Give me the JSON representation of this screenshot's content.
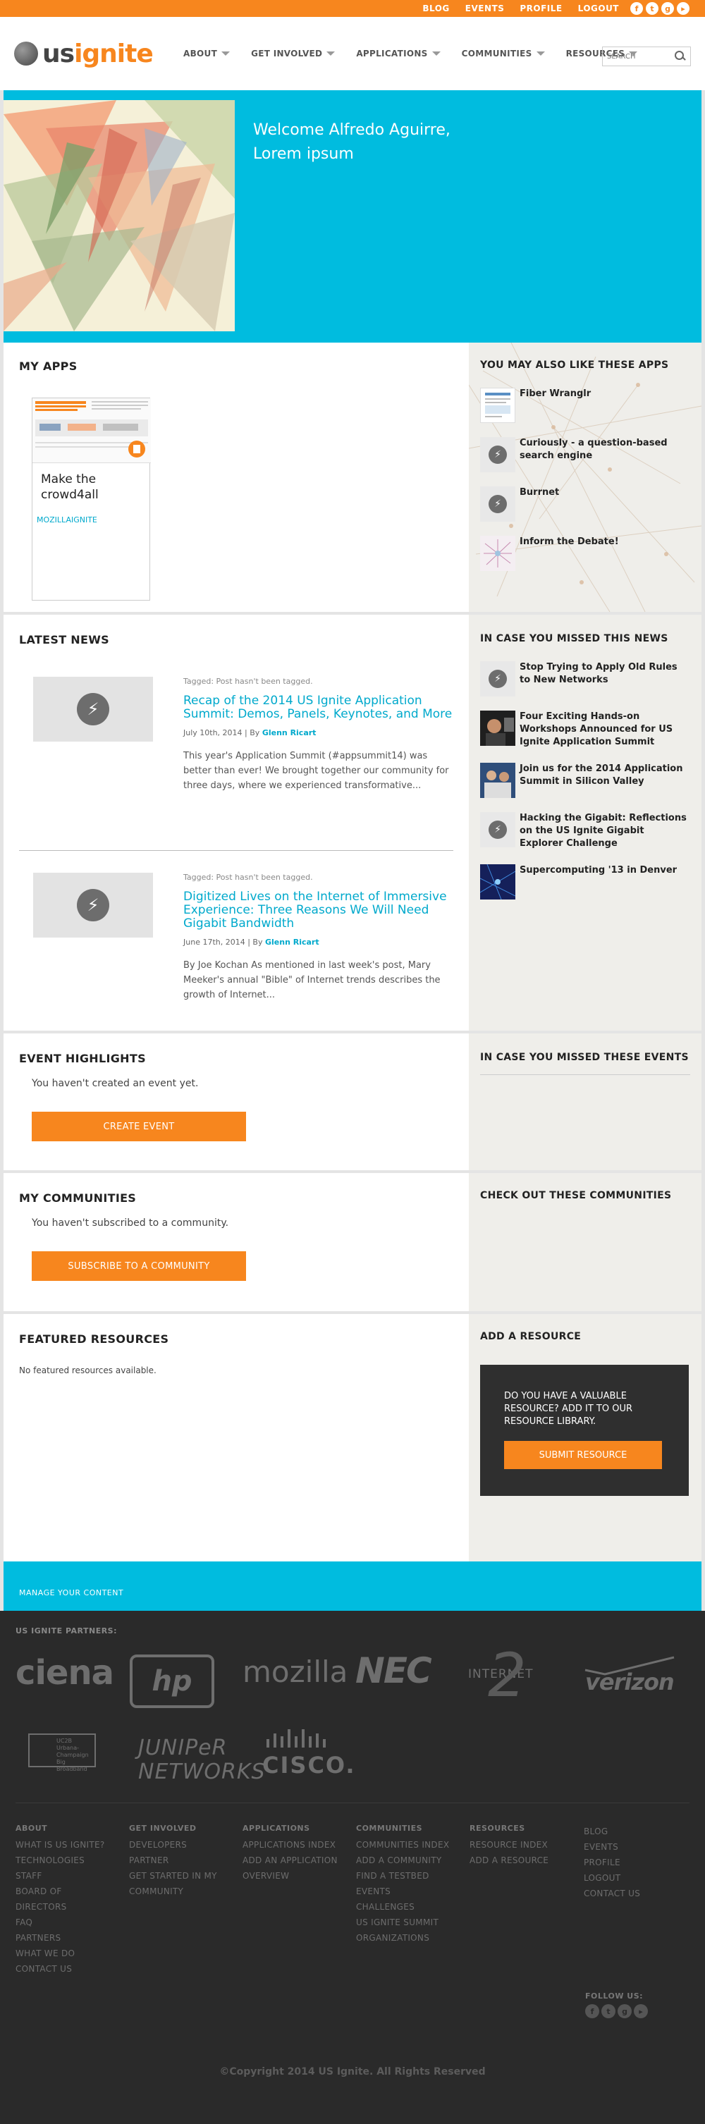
{
  "topbar": {
    "links": [
      "BLOG",
      "EVENTS",
      "PROFILE",
      "LOGOUT"
    ],
    "social_icons": [
      "facebook-icon",
      "twitter-icon",
      "google-plus-icon",
      "youtube-icon"
    ]
  },
  "header": {
    "logo_us": "us",
    "logo_ignite": "ignite",
    "nav": [
      "ABOUT",
      "GET INVOLVED",
      "APPLICATIONS",
      "COMMUNITIES",
      "RESOURCES"
    ],
    "search_placeholder": "SEARCH"
  },
  "hero": {
    "welcome_line1": "Welcome Alfredo Aguirre,",
    "welcome_line2": "Lorem ipsum"
  },
  "my_apps": {
    "title": "MY APPS",
    "app_name_line1": "Make the",
    "app_name_line2": "crowd4all",
    "app_owner": "MOZILLAIGNITE"
  },
  "also_like": {
    "title": "YOU MAY ALSO LIKE THESE APPS",
    "items": [
      "Fiber Wranglr",
      "Curiously - a question-based search engine",
      "Burrnet",
      "Inform the Debate!"
    ]
  },
  "latest_news": {
    "title": "LATEST NEWS",
    "items": [
      {
        "tag": "Tagged: Post hasn't been tagged.",
        "title": "Recap of the 2014 US Ignite Application Summit: Demos, Panels, Keynotes, and More",
        "date": "July 10th, 2014 | By ",
        "author": "Glenn Ricart",
        "excerpt": "This year's Application Summit (#appsummit14) was better than ever! We brought together our community for three days, where we experienced transformative..."
      },
      {
        "tag": "Tagged: Post hasn't been tagged.",
        "title": "Digitized Lives on the Internet of Immersive Experience: Three Reasons We Will Need Gigabit Bandwidth",
        "date": "June 17th, 2014 | By ",
        "author": "Glenn Ricart",
        "excerpt": "By Joe Kochan As mentioned in last week's post, Mary Meeker's annual \"Bible\" of Internet trends describes the growth of Internet..."
      }
    ]
  },
  "missed_news": {
    "title": "IN CASE YOU MISSED THIS NEWS",
    "items": [
      "Stop Trying to Apply Old Rules to New Networks",
      "Four Exciting Hands-on Workshops Announced for US Ignite Application Summit",
      "Join us for the 2014 Application Summit in Silicon Valley",
      "Hacking the Gigabit: Reflections on the US Ignite Gigabit Explorer Challenge",
      "Supercomputing '13 in Denver"
    ]
  },
  "events": {
    "title": "EVENT HIGHLIGHTS",
    "empty": "You haven't created an event yet.",
    "button": "CREATE EVENT",
    "side_title": "IN CASE YOU MISSED THESE EVENTS"
  },
  "communities": {
    "title": "MY COMMUNITIES",
    "empty": "You haven't subscribed to a community.",
    "button": "SUBSCRIBE TO A COMMUNITY",
    "side_title": "CHECK OUT THESE COMMUNITIES"
  },
  "resources": {
    "title": "FEATURED RESOURCES",
    "empty": "No featured resources available.",
    "side_title": "ADD A RESOURCE",
    "box_text": "DO YOU HAVE A VALUABLE RESOURCE? ADD IT TO OUR RESOURCE LIBRARY.",
    "box_button": "SUBMIT RESOURCE"
  },
  "manage": "MANAGE YOUR CONTENT",
  "footer": {
    "partners_title": "US IGNITE PARTNERS:",
    "partners": [
      "ciena",
      "hp",
      "mozilla",
      "NEC",
      "INTERNET",
      "verizon",
      "UC2B Urbana-Champaign Big Broadband",
      "JUNIPeR NETWORKS",
      "CISCO."
    ],
    "columns": [
      {
        "heading": "ABOUT",
        "links": [
          "WHAT IS US IGNITE?",
          "TECHNOLOGIES",
          "STAFF",
          "BOARD OF",
          "DIRECTORS",
          "FAQ",
          "PARTNERS",
          "WHAT WE DO",
          "CONTACT US"
        ]
      },
      {
        "heading": "GET INVOLVED",
        "links": [
          "DEVELOPERS",
          "PARTNER",
          "GET STARTED IN MY",
          "COMMUNITY"
        ]
      },
      {
        "heading": "APPLICATIONS",
        "links": [
          "APPLICATIONS INDEX",
          "ADD AN APPLICATION",
          "OVERVIEW"
        ]
      },
      {
        "heading": "COMMUNITIES",
        "links": [
          "COMMUNITIES INDEX",
          "ADD A COMMUNITY",
          "FIND A TESTBED",
          "EVENTS",
          "CHALLENGES",
          "US IGNITE SUMMIT",
          "ORGANIZATIONS"
        ]
      },
      {
        "heading": "RESOURCES",
        "links": [
          "RESOURCE INDEX",
          "ADD A RESOURCE"
        ]
      },
      {
        "heading": "",
        "links": [
          "BLOG",
          "EVENTS",
          "PROFILE",
          "LOGOUT",
          "CONTACT US"
        ]
      }
    ],
    "follow": "FOLLOW US:",
    "copyright": "©Copyright 2014 US Ignite. All Rights Reserved"
  },
  "colors": {
    "orange": "#f7861e",
    "cyan": "#00bcdf",
    "link": "#00a9cc",
    "footer_bg": "#2a2a2a"
  }
}
